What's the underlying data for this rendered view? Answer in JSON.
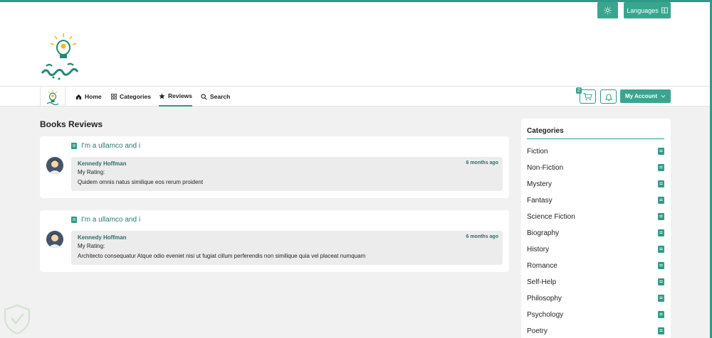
{
  "header": {
    "languages_label": "Languages",
    "theme_icon": "sun-icon"
  },
  "nav": {
    "items": [
      {
        "label": "Home",
        "icon": "home-icon"
      },
      {
        "label": "Categories",
        "icon": "grid-icon"
      },
      {
        "label": "Reviews",
        "icon": "star-icon"
      },
      {
        "label": "Search",
        "icon": "search-icon"
      }
    ],
    "cart_count": "2",
    "account_label": "My Account"
  },
  "main": {
    "title": "Books Reviews",
    "reviews": [
      {
        "book": "I'm a ullamco and i",
        "reviewer": "Kennedy Hoffman",
        "time": "6 months ago",
        "rating_label": "My Rating:",
        "text": "Quidem omnis natus similique eos rerum proident"
      },
      {
        "book": "I'm a ullamco and i",
        "reviewer": "Kennedy Hoffman",
        "time": "6 months ago",
        "rating_label": "My Rating:",
        "text": "Architecto consequatur Atque odio eveniet nisi ut fugiat cillum perferendis non similique quia vel placeat numquam"
      }
    ]
  },
  "sidebar": {
    "title": "Categories",
    "items": [
      "Fiction",
      "Non-Fiction",
      "Mystery",
      "Fantasy",
      "Science Fiction",
      "Biography",
      "History",
      "Romance",
      "Self-Help",
      "Philosophy",
      "Psychology",
      "Poetry"
    ]
  },
  "colors": {
    "accent": "#3aa58f",
    "accent_dark": "#2a7a6c",
    "background": "#f1f1f1"
  }
}
